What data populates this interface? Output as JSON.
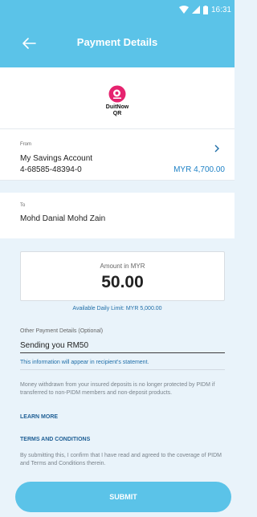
{
  "status_bar": {
    "time": "16:31"
  },
  "header": {
    "title": "Payment Details"
  },
  "logo": {
    "line1": "DuitNow",
    "line2": "QR",
    "mark": "D"
  },
  "from": {
    "label": "From",
    "account_name": "My Savings Account",
    "account_number": "4-68585-48394-0",
    "balance": "MYR 4,700.00"
  },
  "to": {
    "label": "To",
    "recipient_name": "Mohd Danial Mohd Zain"
  },
  "amount": {
    "label": "Amount in MYR",
    "value": "50.00",
    "daily_limit": "Available Daily Limit: MYR 5,000.00"
  },
  "other_details": {
    "label": "Other Payment Details (Optional)",
    "value": "Sending you RM50",
    "note": "This information will appear in recipient's statement."
  },
  "disclaimer": {
    "text": "Money withdrawn from your insured deposits is no longer protected by PIDM if transferred to non-PIDM members and non-deposit products.",
    "learn_more": "LEARN MORE"
  },
  "terms": {
    "title": "TERMS AND CONDITIONS",
    "text": "By submitting this, I confirm that I have read and agreed to the coverage of PIDM and Terms and Conditions therein."
  },
  "submit": {
    "label": "SUBMIT"
  },
  "colors": {
    "primary": "#5bc3e8",
    "link": "#1f6ea8",
    "brand": "#e6236f"
  }
}
